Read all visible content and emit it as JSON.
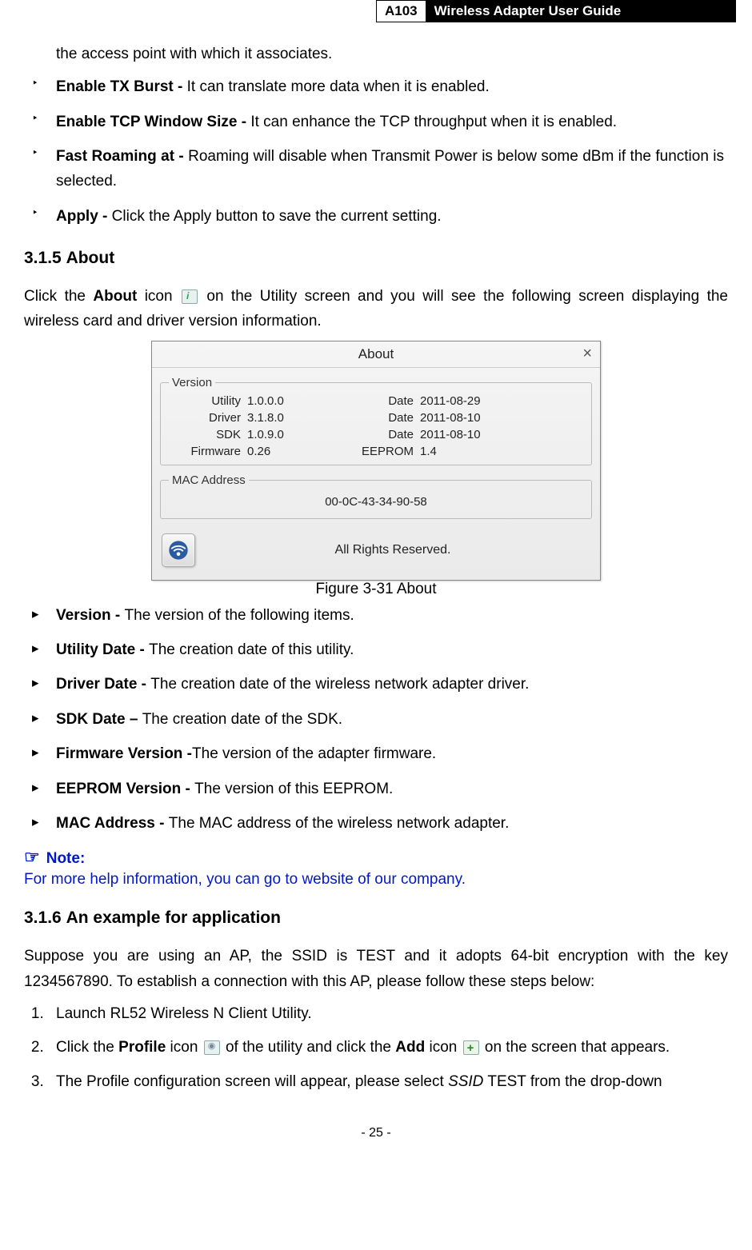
{
  "header": {
    "code": "A103",
    "title": "Wireless Adapter User Guide"
  },
  "topline": "the access point with which it associates.",
  "intro_bullets": [
    {
      "b": "Enable TX Burst - ",
      "t": "It can translate more data when it is enabled."
    },
    {
      "b": "Enable TCP Window Size - ",
      "t": "It can enhance the TCP throughput when it is enabled."
    },
    {
      "b": "Fast Roaming at - ",
      "t": "Roaming will disable when Transmit Power is below some dBm if the function is selected."
    },
    {
      "b": "Apply - ",
      "t": "Click the Apply button to save the current setting."
    }
  ],
  "sec315": {
    "num": "3.1.5",
    "title": "About"
  },
  "about_para_a": "Click the ",
  "about_para_b": "About",
  "about_para_c": " icon ",
  "about_para_d": " on the Utility screen and you will see the following screen displaying the wireless card and driver version information.",
  "about_dialog": {
    "title": "About",
    "legend_version": "Version",
    "rows": [
      {
        "l1": "Utility",
        "v1": "1.0.0.0",
        "l2": "Date",
        "v2": "2011-08-29"
      },
      {
        "l1": "Driver",
        "v1": "3.1.8.0",
        "l2": "Date",
        "v2": "2011-08-10"
      },
      {
        "l1": "SDK",
        "v1": "1.0.9.0",
        "l2": "Date",
        "v2": "2011-08-10"
      },
      {
        "l1": "Firmware",
        "v1": "0.26",
        "l2": "EEPROM",
        "v2": "1.4"
      }
    ],
    "legend_mac": "MAC Address",
    "mac": "00-0C-43-34-90-58",
    "rights": "All Rights Reserved."
  },
  "fig_caption": "Figure 3-31 About",
  "about_bullets": [
    {
      "b": "Version - ",
      "t": "The version of the following items."
    },
    {
      "b": "Utility Date - ",
      "t": "The creation date of this utility."
    },
    {
      "b": "Driver Date - ",
      "t": "The creation date of the wireless network adapter driver."
    },
    {
      "b": "SDK Date – ",
      "t": "The creation date of the SDK."
    },
    {
      "b": "Firmware Version -",
      "t": "The version of the adapter firmware."
    },
    {
      "b": "EEPROM Version - ",
      "t": "The version of this EEPROM."
    },
    {
      "b": "MAC Address - ",
      "t": "The MAC address of the wireless network adapter."
    }
  ],
  "note": {
    "head": "Note:",
    "body": "For more help information, you can go to website of our company."
  },
  "sec316": {
    "num": "3.1.6",
    "title": "An example for application"
  },
  "example_para": "Suppose you are using an AP, the SSID is TEST and it adopts 64-bit encryption with the key 1234567890. To establish a connection with this AP, please follow these steps below:",
  "steps": {
    "s1": "Launch RL52 Wireless N Client Utility.",
    "s2a": "Click the ",
    "s2b": "Profile",
    "s2c": " icon ",
    "s2d": " of the utility and click the ",
    "s2e": "Add",
    "s2f": " icon ",
    "s2g": " on the screen that appears.",
    "s3a": "The Profile configuration screen will appear, please select ",
    "s3b": "SSID",
    "s3c": " TEST from the drop-down"
  },
  "footer": "- 25 -"
}
